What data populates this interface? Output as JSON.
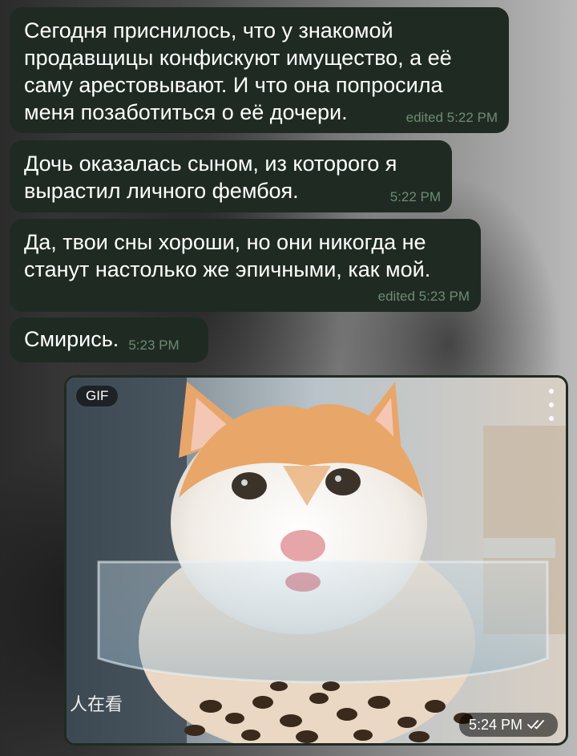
{
  "messages": [
    {
      "text": "Сегодня приснилось, что у знакомой продавщицы конфискуют имущество, а её саму арестовывают. И что она попросила меня позаботиться о её дочери.",
      "meta": "edited 5:22 PM"
    },
    {
      "text": "Дочь оказалась сыном, из которого я вырастил личного фембоя.",
      "meta": "5:22 PM"
    },
    {
      "text": "Да, твои сны хороши, но они никогда не станут настолько же эпичными, как мой.",
      "meta": "edited 5:23 PM"
    },
    {
      "text": "Смирись.",
      "meta": "5:23 PM"
    }
  ],
  "gif_message": {
    "badge": "GIF",
    "watermark": "人在看",
    "time": "5:24 PM",
    "status_icon": "double-check-icon",
    "menu_icon": "more-vertical-icon"
  },
  "colors": {
    "bubble_bg": "#1f2b22",
    "meta_text": "#6f8a73",
    "message_text": "#ffffff"
  }
}
